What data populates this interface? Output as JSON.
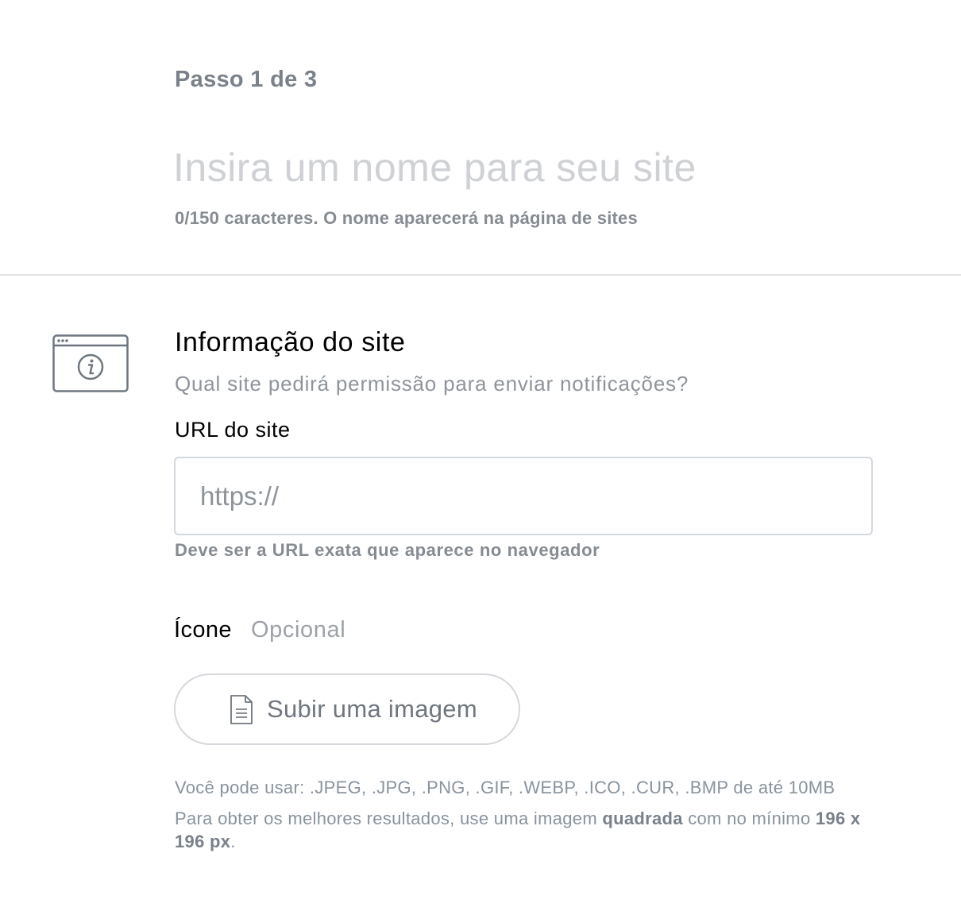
{
  "step": {
    "label": "Passo 1 de 3"
  },
  "site_name": {
    "value": "",
    "placeholder": "Insira um nome para seu site",
    "hint": "0/150 caracteres. O nome aparecerá na página de sites"
  },
  "site_info": {
    "icon": "browser-info-icon",
    "title": "Informação do site",
    "subtitle": "Qual site pedirá permissão para enviar notificações?",
    "url": {
      "label": "URL do site",
      "value": "",
      "placeholder": "https://",
      "hint": "Deve ser a URL exata que aparece no navegador"
    }
  },
  "icon_field": {
    "label": "Ícone",
    "optional": "Opcional",
    "upload": {
      "icon": "document-icon",
      "label": "Subir uma imagem"
    },
    "formats": "Você pode usar: .JPEG, .JPG, .PNG, .GIF, .WEBP, .ICO, .CUR, .BMP de até 10MB",
    "best_results": {
      "prefix": "Para obter os melhores resultados, use uma imagem ",
      "emphasis": "quadrada",
      "middle": " com no mínimo ",
      "size": "196 x 196 px",
      "suffix": "."
    }
  },
  "colors": {
    "muted_text": "#868b92",
    "placeholder": "#cfd1d4",
    "border": "#d5d8dc",
    "divider": "#dfe1e4",
    "icon_stroke": "#6e7780"
  }
}
